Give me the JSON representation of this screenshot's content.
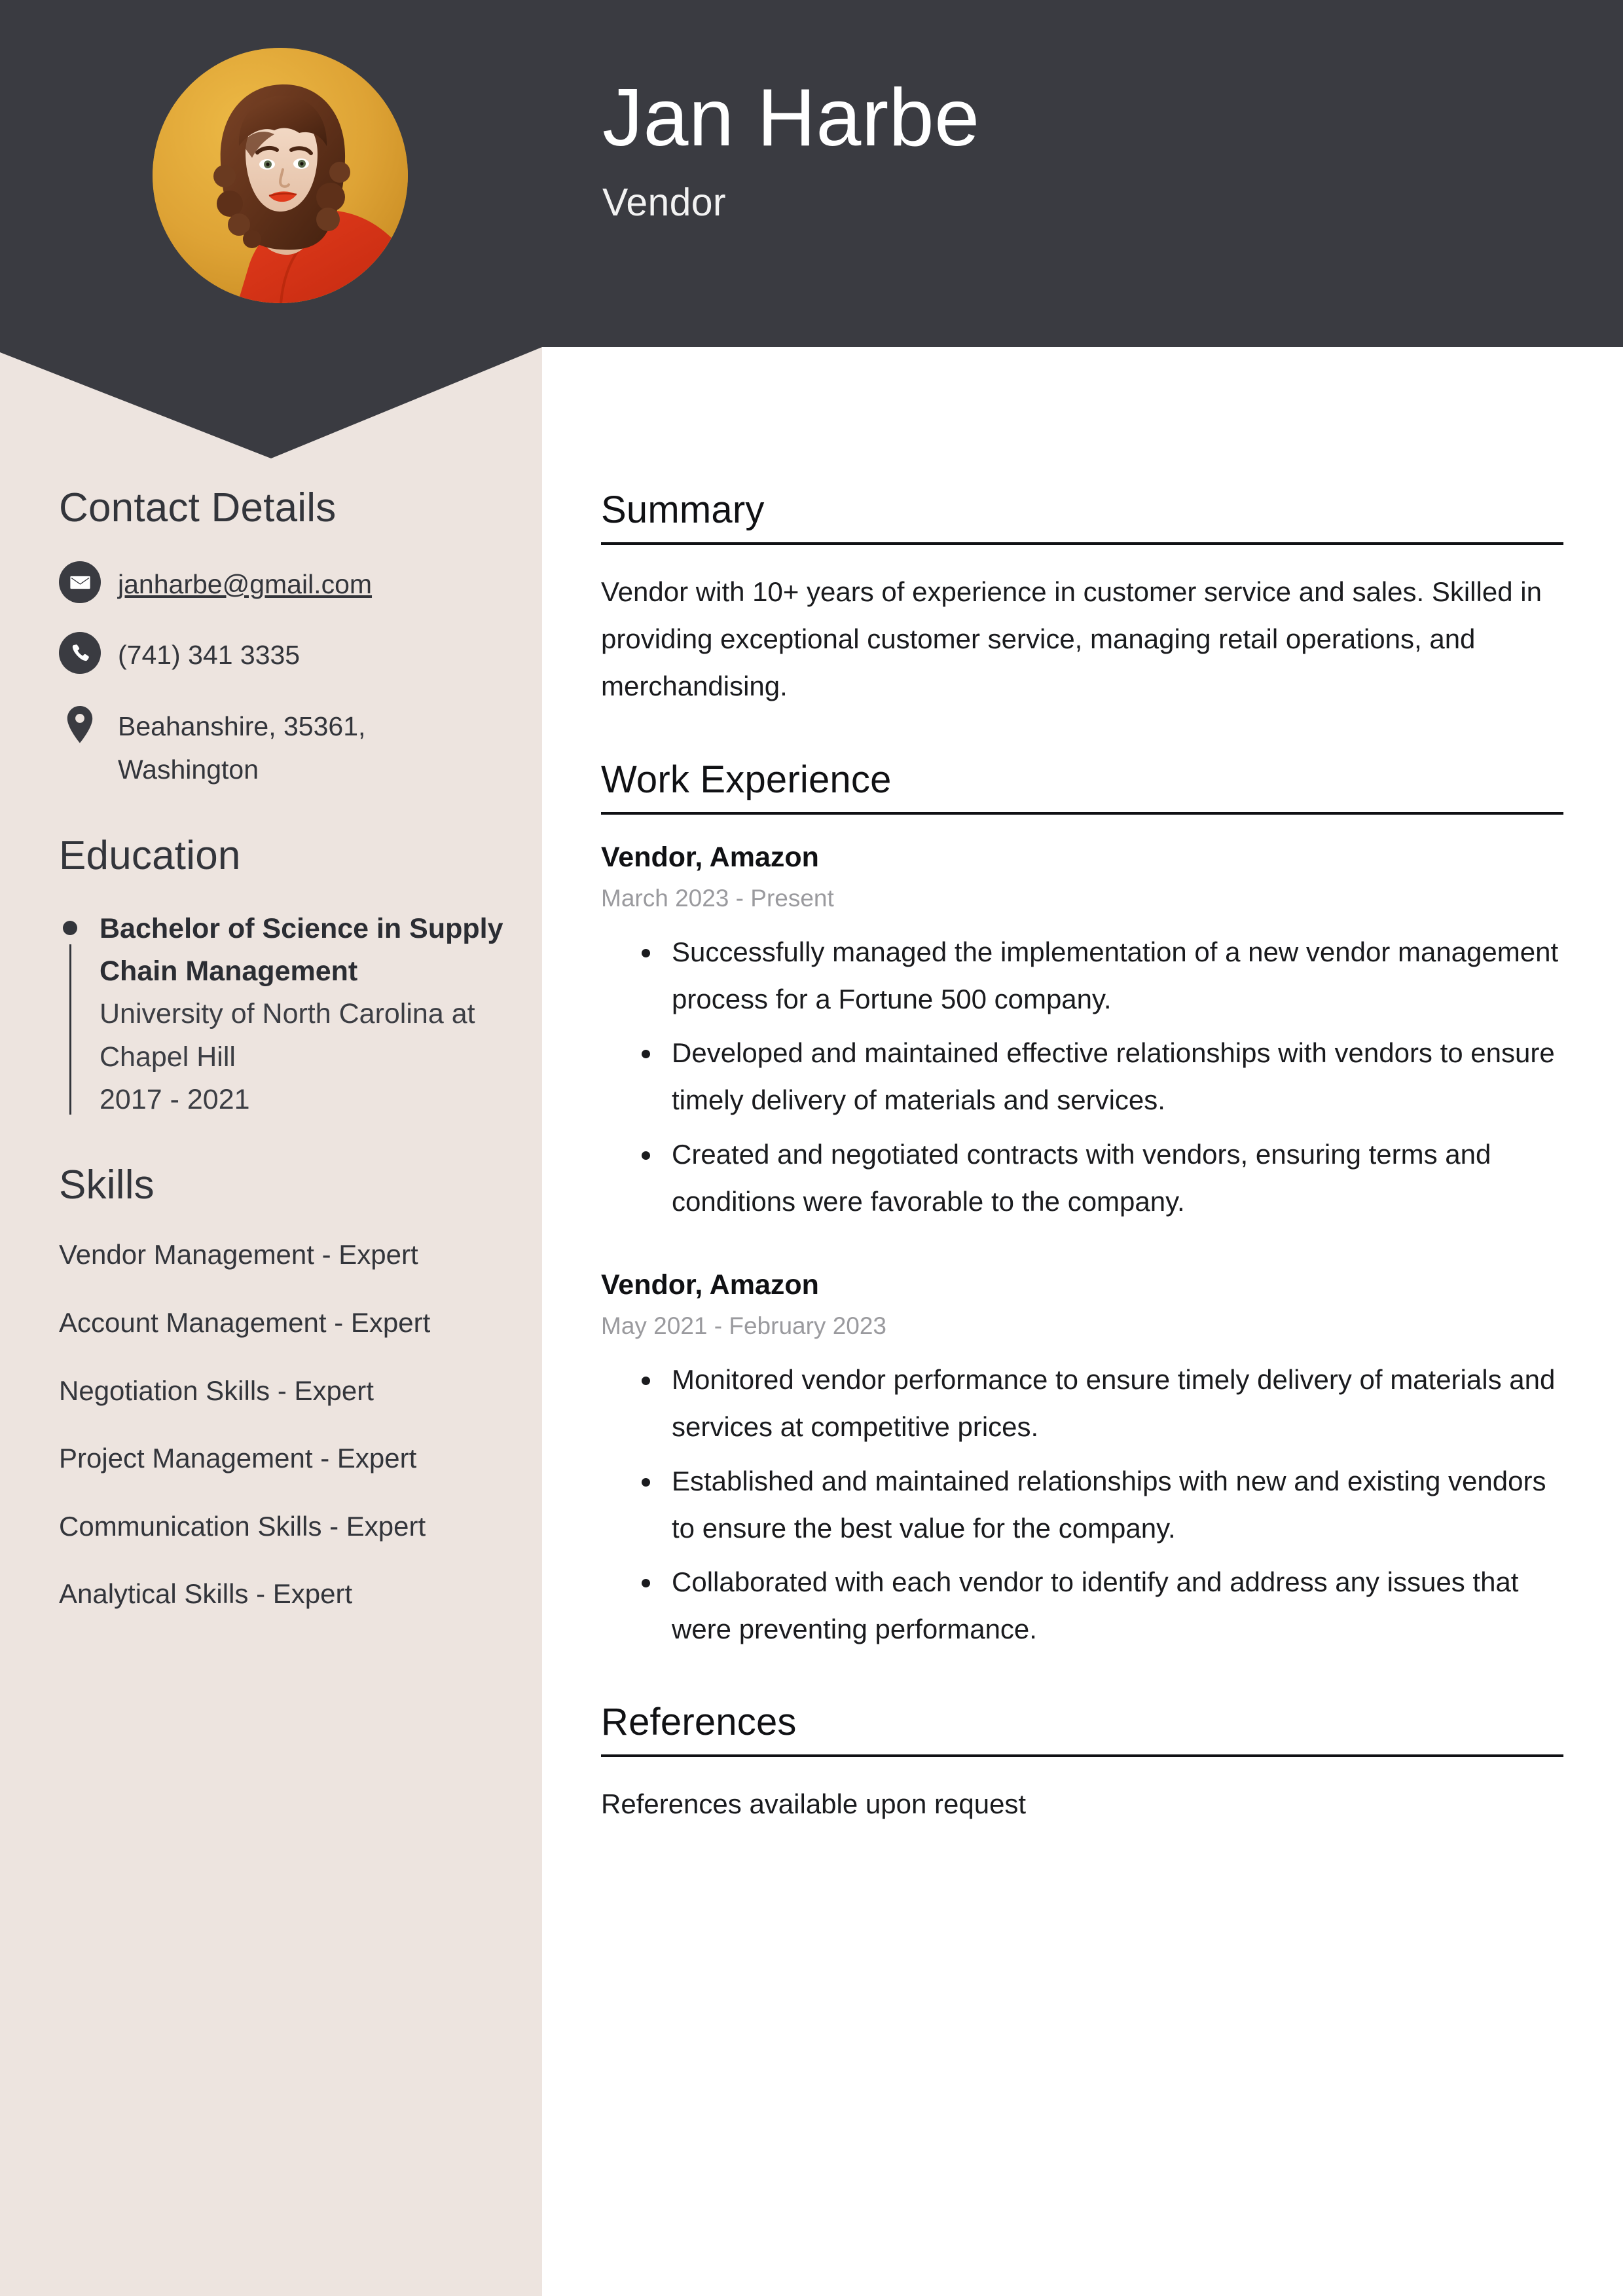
{
  "theme": {
    "header_bg": "#3A3B41",
    "sidebar_bg": "#EDE4DF",
    "page_bg": "#FFFFFF",
    "text_dark": "#33353B",
    "muted_text": "#9A9A9E",
    "avatar_bg": "#DDA134"
  },
  "header": {
    "name": "Jan Harbe",
    "job_title": "Vendor",
    "avatar_alt": "portrait-photo"
  },
  "sidebar": {
    "contact": {
      "heading": "Contact Details",
      "items": [
        {
          "icon": "envelope-icon",
          "value": "janharbe@gmail.com",
          "link": true
        },
        {
          "icon": "phone-icon",
          "value": "(741) 341 3335",
          "link": false
        },
        {
          "icon": "location-pin-icon",
          "value": "Beahanshire, 35361, Washington",
          "link": false
        }
      ]
    },
    "education": {
      "heading": "Education",
      "items": [
        {
          "degree": "Bachelor of Science in Supply Chain Management",
          "school": "University of North Carolina at Chapel Hill",
          "dates": "2017 - 2021"
        }
      ]
    },
    "skills": {
      "heading": "Skills",
      "items": [
        "Vendor Management - Expert",
        "Account Management - Expert",
        "Negotiation Skills - Expert",
        "Project Management - Expert",
        "Communication Skills - Expert",
        "Analytical Skills - Expert"
      ]
    }
  },
  "main": {
    "summary": {
      "heading": "Summary",
      "text": "Vendor with 10+ years of experience in customer service and sales. Skilled in providing exceptional customer service, managing retail operations, and merchandising."
    },
    "work_experience": {
      "heading": "Work Experience",
      "jobs": [
        {
          "role": "Vendor, Amazon",
          "dates": "March 2023 - Present",
          "bullets": [
            "Successfully managed the implementation of a new vendor management process for a Fortune 500 company.",
            "Developed and maintained effective relationships with vendors to ensure timely delivery of materials and services.",
            "Created and negotiated contracts with vendors, ensuring terms and conditions were favorable to the company."
          ]
        },
        {
          "role": "Vendor, Amazon",
          "dates": "May 2021 - February 2023",
          "bullets": [
            "Monitored vendor performance to ensure timely delivery of materials and services at competitive prices.",
            "Established and maintained relationships with new and existing vendors to ensure the best value for the company.",
            "Collaborated with each vendor to identify and address any issues that were preventing performance."
          ]
        }
      ]
    },
    "references": {
      "heading": "References",
      "text": "References available upon request"
    }
  }
}
